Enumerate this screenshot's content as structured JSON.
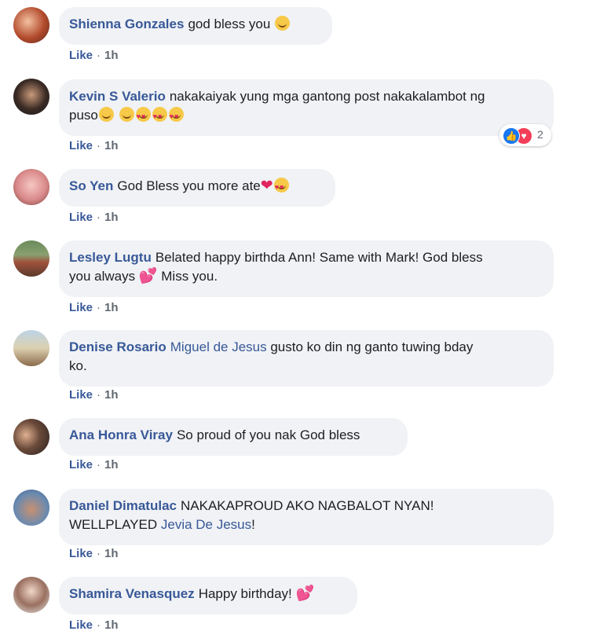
{
  "colors": {
    "name": "#385898",
    "bubble_bg": "#f0f2f5",
    "text": "#1c1e21",
    "meta": "#606770"
  },
  "actions": {
    "like": "Like",
    "sep": "·"
  },
  "comments": [
    {
      "author": "Shienna Gonzales",
      "text": "god bless you",
      "emoji": "blush",
      "time": "1h"
    },
    {
      "author": "Kevin S Valerio",
      "text1": "nakakaiyak yung mga gantong post nakakalambot ng",
      "text2": "puso",
      "time": "1h",
      "reactions": {
        "count": "2",
        "icons": [
          "like-icon",
          "love-icon"
        ]
      }
    },
    {
      "author": "So Yen",
      "text": "God Bless you more ate",
      "time": "1h"
    },
    {
      "author": "Lesley Lugtu",
      "text1": "Belated happy birthda Ann! Same with Mark! God bless",
      "text2a": "you always",
      "text2b": "Miss you.",
      "time": "1h"
    },
    {
      "author": "Denise Rosario",
      "mention": "Miguel de Jesus",
      "text1": "gusto ko din ng ganto tuwing bday",
      "text2": "ko.",
      "time": "1h"
    },
    {
      "author": "Ana Honra Viray",
      "text": "So proud of you nak God bless",
      "time": "1h"
    },
    {
      "author": "Daniel Dimatulac",
      "text1": "NAKAKAPROUD AKO NAGBALOT NYAN!",
      "text2a": "WELLPLAYED",
      "mention": "Jevia De Jesus",
      "text2b": "!",
      "time": "1h"
    },
    {
      "author": "Shamira Venasquez",
      "text": "Happy birthday!",
      "time": "1h"
    }
  ]
}
